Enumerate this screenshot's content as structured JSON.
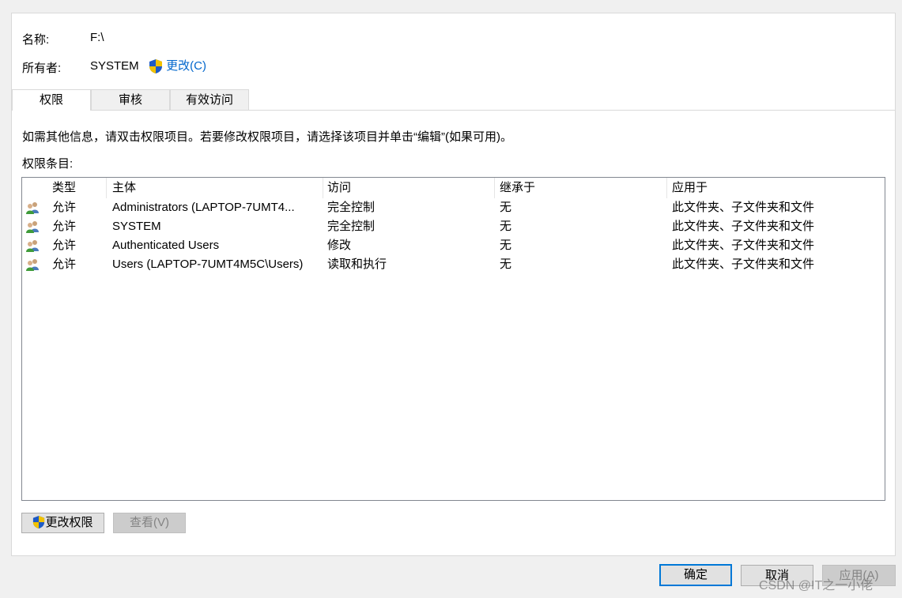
{
  "info": {
    "name_label": "名称:",
    "name_value": "F:\\",
    "owner_label": "所有者:",
    "owner_value": "SYSTEM",
    "change_owner_link": "更改(C)"
  },
  "tabs": [
    {
      "label": "权限",
      "active": true
    },
    {
      "label": "审核",
      "active": false
    },
    {
      "label": "有效访问",
      "active": false
    }
  ],
  "instruction": "如需其他信息，请双击权限项目。若要修改权限项目，请选择该项目并单击“编辑”(如果可用)。",
  "entries_label": "权限条目:",
  "columns": [
    "类型",
    "主体",
    "访问",
    "继承于",
    "应用于"
  ],
  "rows": [
    {
      "type": "允许",
      "principal": "Administrators (LAPTOP-7UMT4...",
      "access": "完全控制",
      "inherited": "无",
      "applies": "此文件夹、子文件夹和文件"
    },
    {
      "type": "允许",
      "principal": "SYSTEM",
      "access": "完全控制",
      "inherited": "无",
      "applies": "此文件夹、子文件夹和文件"
    },
    {
      "type": "允许",
      "principal": "Authenticated Users",
      "access": "修改",
      "inherited": "无",
      "applies": "此文件夹、子文件夹和文件"
    },
    {
      "type": "允许",
      "principal": "Users (LAPTOP-7UMT4M5C\\Users)",
      "access": "读取和执行",
      "inherited": "无",
      "applies": "此文件夹、子文件夹和文件"
    }
  ],
  "buttons": {
    "change_permissions": "更改权限",
    "view": "查看(V)",
    "ok": "确定",
    "cancel": "取消",
    "apply": "应用(A)"
  },
  "watermark": "CSDN @IT之一小佬",
  "colors": {
    "accent": "#0078d7",
    "link": "#0066cc",
    "disabled_text": "#838383"
  }
}
